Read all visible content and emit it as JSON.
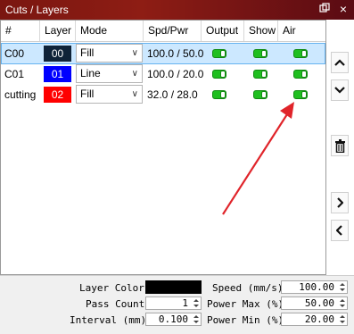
{
  "window": {
    "title": "Cuts / Layers"
  },
  "columns": [
    "#",
    "Layer",
    "Mode",
    "Spd/Pwr",
    "Output",
    "Show",
    "Air"
  ],
  "rows": [
    {
      "name": "C00",
      "layer": "00",
      "layer_color": "#0f2338",
      "mode": "Fill",
      "spd_pwr": "100.0 / 50.0",
      "output": true,
      "show": true,
      "air": true,
      "selected": true
    },
    {
      "name": "C01",
      "layer": "01",
      "layer_color": "#0000ff",
      "mode": "Line",
      "spd_pwr": "100.0 / 20.0",
      "output": true,
      "show": true,
      "air": true,
      "selected": false
    },
    {
      "name": "cutting",
      "layer": "02",
      "layer_color": "#ff0000",
      "mode": "Fill",
      "spd_pwr": "32.0 / 28.0",
      "output": true,
      "show": true,
      "air": true,
      "selected": false
    }
  ],
  "side_buttons": [
    {
      "icon": "chevron-up-icon",
      "glyph": "^"
    },
    {
      "icon": "chevron-down-icon",
      "glyph": "v"
    },
    {
      "icon": "trash-icon",
      "glyph": ""
    },
    {
      "icon": "chevron-right-icon",
      "glyph": ">"
    },
    {
      "icon": "chevron-left-icon",
      "glyph": "<"
    }
  ],
  "settings": {
    "layer_color_label": "Layer Color",
    "layer_color_value": "#000000",
    "speed_label": "Speed (mm/s)",
    "speed_value": "100.00",
    "pass_count_label": "Pass Count",
    "pass_count_value": "1",
    "power_max_label": "Power Max (%)",
    "power_max_value": "50.00",
    "interval_label": "Interval (mm)",
    "interval_value": "0.100",
    "power_min_label": "Power Min (%)",
    "power_min_value": "20.00"
  },
  "annotation": {
    "arrow_color": "#e0242a"
  }
}
